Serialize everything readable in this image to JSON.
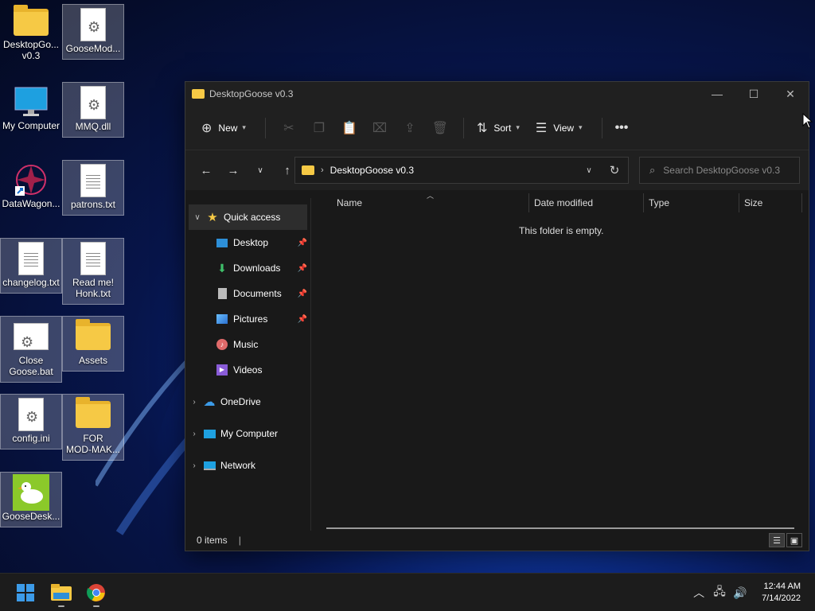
{
  "desktop": {
    "icons": [
      {
        "label": "DesktopGo...\nv0.3",
        "type": "folder"
      },
      {
        "label": "GooseMod...",
        "type": "settings-file"
      },
      {
        "label": "My Computer",
        "type": "computer"
      },
      {
        "label": "MMQ.dll",
        "type": "settings-file"
      },
      {
        "label": "DataWagon...",
        "type": "shortcut"
      },
      {
        "label": "patrons.txt",
        "type": "text-file"
      },
      {
        "label": "changelog.txt",
        "type": "text-file"
      },
      {
        "label": "Read me!\nHonk.txt",
        "type": "text-file"
      },
      {
        "label": "Close\nGoose.bat",
        "type": "batch-file"
      },
      {
        "label": "Assets",
        "type": "folder"
      },
      {
        "label": "config.ini",
        "type": "settings-file"
      },
      {
        "label": "FOR\nMOD-MAK...",
        "type": "folder"
      },
      {
        "label": "GooseDesk...",
        "type": "app"
      }
    ]
  },
  "window": {
    "title": "DesktopGoose v0.3",
    "toolbar": {
      "new_label": "New",
      "sort_label": "Sort",
      "view_label": "View"
    },
    "address": {
      "path": "DesktopGoose v0.3"
    },
    "search": {
      "placeholder": "Search DesktopGoose v0.3"
    },
    "nav": {
      "quick_access": "Quick access",
      "items": [
        "Desktop",
        "Downloads",
        "Documents",
        "Pictures",
        "Music",
        "Videos"
      ],
      "onedrive": "OneDrive",
      "my_computer": "My Computer",
      "network": "Network"
    },
    "columns": {
      "name": "Name",
      "date_modified": "Date modified",
      "type": "Type",
      "size": "Size"
    },
    "empty_message": "This folder is empty.",
    "status": "0 items"
  },
  "taskbar": {
    "time": "12:44 AM",
    "date": "7/14/2022"
  },
  "colors": {
    "accent": "#3c9be8",
    "folder": "#f6c945",
    "window_bg": "#191919"
  }
}
